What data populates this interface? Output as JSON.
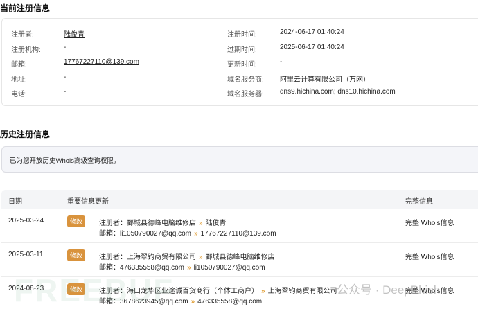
{
  "current": {
    "title": "当前注册信息",
    "left": [
      {
        "label": "注册者:",
        "value": "陆俊青"
      },
      {
        "label": "注册机构:",
        "value": "-"
      },
      {
        "label": "邮箱:",
        "value": "17767227110@139.com"
      },
      {
        "label": "地址:",
        "value": "-"
      },
      {
        "label": "电话:",
        "value": "-"
      }
    ],
    "right": [
      {
        "label": "注册时间:",
        "value": "2024-06-17 01:40:24"
      },
      {
        "label": "过期时间:",
        "value": "2025-06-17 01:40:24"
      },
      {
        "label": "更新时间:",
        "value": "-"
      },
      {
        "label": "域名服务商:",
        "value": "阿里云计算有限公司（万网）"
      },
      {
        "label": "域名服务器:",
        "value": "dns9.hichina.com; dns10.hichina.com"
      }
    ]
  },
  "history": {
    "title": "历史注册信息",
    "notice": "已为您开放历史Whois高级查询权限。",
    "columns": [
      "日期",
      "重要信息更新",
      "完整信息"
    ],
    "rows": [
      {
        "date": "2025-03-24",
        "tag": "修改",
        "reg_label": "注册者：",
        "reg_from": "鄄城县德峰电脑维修店",
        "reg_to": "陆俊青",
        "mail_label": "邮箱：",
        "mail_from": "li1050790027@qq.com",
        "mail_to": "17767227110@139.com",
        "link": "完整 Whois信息"
      },
      {
        "date": "2025-03-11",
        "tag": "修改",
        "reg_label": "注册者：",
        "reg_from": "上海翠钧商贸有限公司",
        "reg_to": "鄄城县德峰电脑维修店",
        "mail_label": "邮箱：",
        "mail_from": "476335558@qq.com",
        "mail_to": "li1050790027@qq.com",
        "link": "完整 Whois信息"
      },
      {
        "date": "2024-08-23",
        "tag": "修改",
        "reg_label": "注册者：",
        "reg_from": "海口龙华区业途诚百货商行（个体工商户）",
        "reg_to": "上海翠钧商贸有限公司",
        "mail_label": "邮箱：",
        "mail_from": "3678623945@qq.com",
        "mail_to": "476335558@qq.com",
        "link": "完整 Whois信息"
      }
    ]
  },
  "watermarks": {
    "freebuf": "FREEBUF",
    "wechat": "公众号 · DeepPhish"
  },
  "colors": {
    "tag": "#d9933d",
    "arrow": "#e2a13b"
  }
}
